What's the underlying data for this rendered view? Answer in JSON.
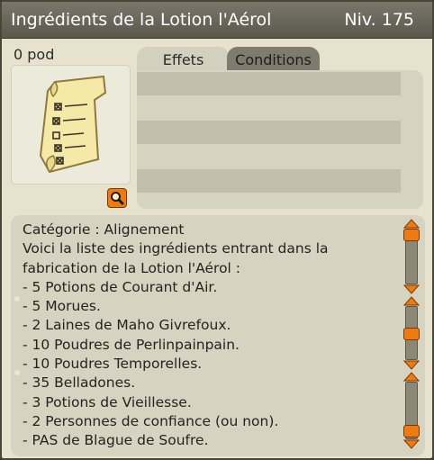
{
  "window": {
    "title": "Ingrédients de la Lotion l'Aérol",
    "level": "Niv. 175"
  },
  "item": {
    "pods": "0 pod",
    "icon": "recipe-scroll-icon",
    "zoom_icon": "magnifier-icon"
  },
  "tabs": [
    {
      "label": "Effets",
      "active": true
    },
    {
      "label": "Conditions",
      "active": false
    }
  ],
  "description": {
    "lines": [
      "Catégorie : Alignement",
      "Voici la liste des ingrédients entrant dans la",
      "fabrication de la Lotion l'Aérol :",
      "- 5 Potions de Courant d'Air.",
      "- 5 Morues.",
      "- 2 Laines de Maho Givrefoux.",
      "- 10 Poudres de Perlinpainpain.",
      "- 10 Poudres Temporelles.",
      "- 35 Belladones.",
      "- 3 Potions de Vieillesse.",
      "- 2 Personnes de confiance (ou non).",
      "- PAS de Blague de Soufre."
    ]
  },
  "colors": {
    "accent": "#f07a10",
    "titlebar": "#5a584d",
    "panel": "#d6d3c1"
  }
}
